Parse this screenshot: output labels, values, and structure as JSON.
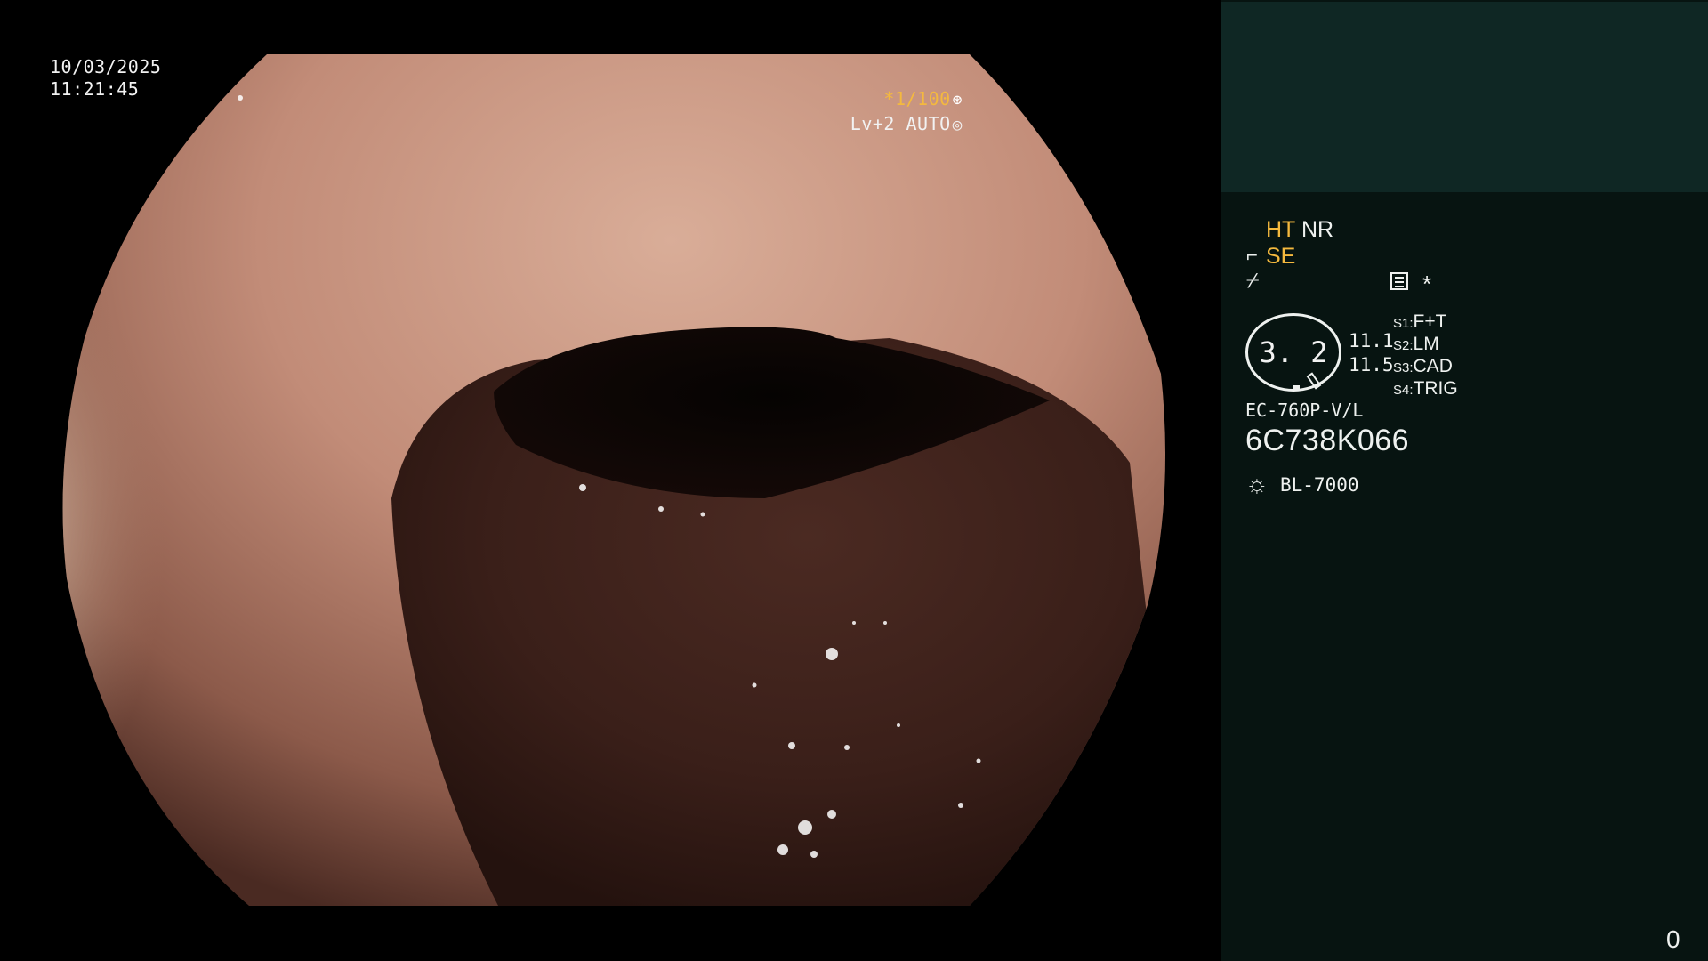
{
  "osd": {
    "date": "10/03/2025",
    "time": "11:21:45",
    "shutter": "*1/100",
    "shutter_icon": "shutter-icon",
    "level": "Lv+2 AUTO",
    "level_icon": "iris-icon"
  },
  "panel": {
    "ht": "HT",
    "nr": "NR",
    "se": "SE",
    "star": "*",
    "zoom_value": "3. 2",
    "value_a": "11.1",
    "value_b": "11.5",
    "switches": [
      {
        "key": "S1:",
        "value": "F+T"
      },
      {
        "key": "S2:",
        "value": "LM"
      },
      {
        "key": "S3:",
        "value": "CAD"
      },
      {
        "key": "S4:",
        "value": "TRIG"
      }
    ],
    "model": "EC-760P-V/L",
    "serial": "6C738K066",
    "lamp": "BL-7000",
    "counter": "0"
  },
  "colors": {
    "accent": "#f4b93e",
    "panel_bg": "#071411",
    "thumb_bg": "#0f2724",
    "text": "#eef1ef"
  }
}
